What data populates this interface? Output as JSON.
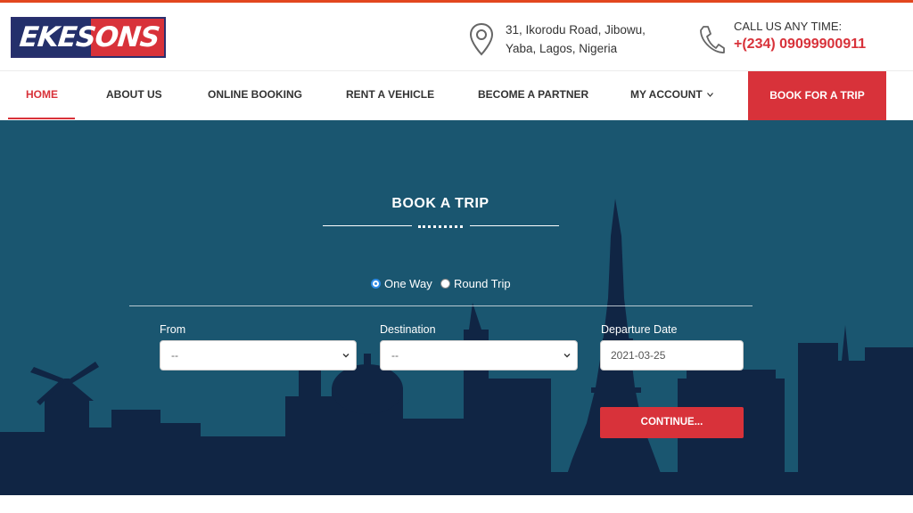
{
  "brand": {
    "logo_text": "EKESONS",
    "colors": {
      "primary_red": "#d8323a",
      "navy": "#24306b",
      "hero_blue": "#1a5670",
      "skyline": "#102544"
    }
  },
  "contact": {
    "address_line1": "31, Ikorodu Road, Jibowu,",
    "address_line2": "Yaba, Lagos, Nigeria",
    "address_icon": "map-pin-icon",
    "call_label": "CALL US ANY TIME:",
    "phone": "+(234) 09099900911",
    "phone_icon": "phone-icon"
  },
  "nav": {
    "items": [
      {
        "label": "HOME",
        "active": true
      },
      {
        "label": "ABOUT US",
        "active": false
      },
      {
        "label": "ONLINE BOOKING",
        "active": false
      },
      {
        "label": "RENT A VEHICLE",
        "active": false
      },
      {
        "label": "BECOME A PARTNER",
        "active": false
      },
      {
        "label": "MY ACCOUNT",
        "active": false,
        "dropdown": true
      }
    ],
    "cta_label": "BOOK FOR A TRIP"
  },
  "booking": {
    "title": "BOOK A TRIP",
    "trip_types": [
      {
        "label": "One Way",
        "selected": true
      },
      {
        "label": "Round Trip",
        "selected": false
      }
    ],
    "from": {
      "label": "From",
      "value": "--"
    },
    "destination": {
      "label": "Destination",
      "value": "--"
    },
    "departure": {
      "label": "Departure Date",
      "value": "2021-03-25"
    },
    "continue_label": "CONTINUE..."
  }
}
